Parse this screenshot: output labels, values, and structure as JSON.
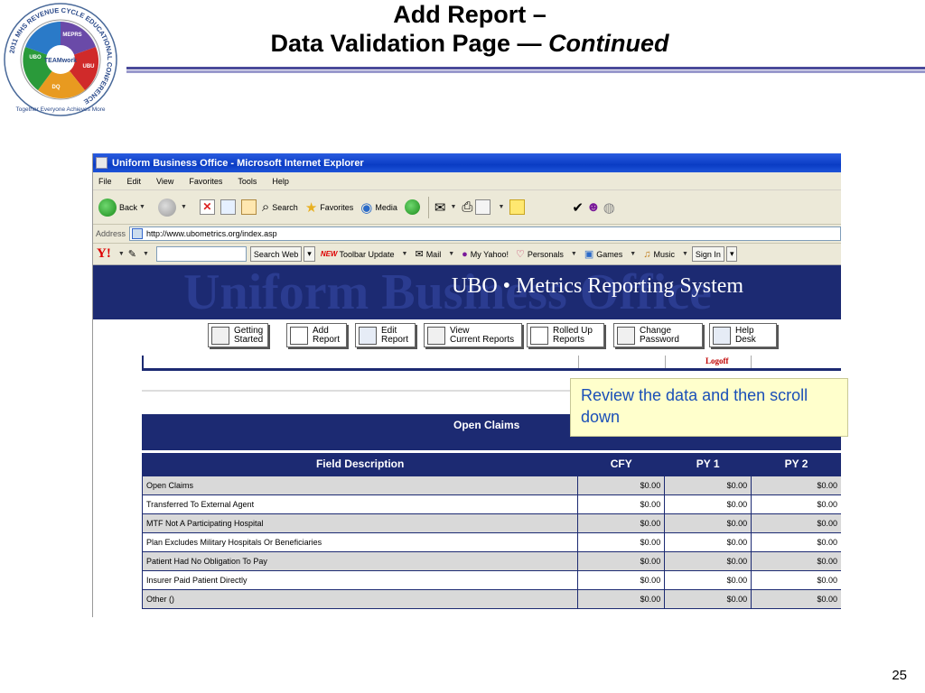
{
  "slide": {
    "title_line1": "Add Report –",
    "title_line2": "Data Validation Page —",
    "title_italic": "Continued",
    "page_number": "25",
    "logo": {
      "ring_text": "2011 MHS REVENUE CYCLE EDUCATIONAL CONFERENCE",
      "center": "TEAMwork",
      "segments": [
        "MEPRS",
        "UBO",
        "UBU",
        "DQ"
      ],
      "tagline": "Together Everyone Achieves More"
    }
  },
  "browser": {
    "window_title": "Uniform Business Office - Microsoft Internet Explorer",
    "menu": [
      "File",
      "Edit",
      "View",
      "Favorites",
      "Tools",
      "Help"
    ],
    "toolbar": {
      "back": "Back",
      "search": "Search",
      "favorites": "Favorites",
      "media": "Media"
    },
    "address_label": "Address",
    "url": "http://www.ubometrics.org/index.asp",
    "yahoo": {
      "logo": "Y!",
      "search_web": "Search Web",
      "new_badge": "NEW",
      "toolbar_update": "Toolbar Update",
      "mail": "Mail",
      "my_yahoo": "My Yahoo!",
      "personals": "Personals",
      "games": "Games",
      "music": "Music",
      "sign_in": "Sign In"
    }
  },
  "page": {
    "banner_bg": "Uniform Business Office",
    "banner_title": "UBO • Metrics Reporting System",
    "nav": [
      {
        "label": "Getting\nStarted"
      },
      {
        "label": "Add\nReport"
      },
      {
        "label": "Edit\nReport"
      },
      {
        "label": "View\nCurrent Reports"
      },
      {
        "label": "Rolled Up\nReports"
      },
      {
        "label": "Change\nPassword"
      },
      {
        "label": "Help\nDesk"
      }
    ],
    "logoff": "Logoff",
    "section_title": "Open Claims",
    "columns": [
      "Field Description",
      "CFY",
      "PY 1",
      "PY 2"
    ],
    "rows": [
      {
        "desc": "Open Claims",
        "cfy": "$0.00",
        "py1": "$0.00",
        "py2": "$0.00"
      },
      {
        "desc": "Transferred To External Agent",
        "cfy": "$0.00",
        "py1": "$0.00",
        "py2": "$0.00"
      },
      {
        "desc": "MTF Not A Participating Hospital",
        "cfy": "$0.00",
        "py1": "$0.00",
        "py2": "$0.00"
      },
      {
        "desc": "Plan Excludes Military Hospitals Or Beneficiaries",
        "cfy": "$0.00",
        "py1": "$0.00",
        "py2": "$0.00"
      },
      {
        "desc": "Patient Had No Obligation To Pay",
        "cfy": "$0.00",
        "py1": "$0.00",
        "py2": "$0.00"
      },
      {
        "desc": "Insurer Paid Patient Directly",
        "cfy": "$0.00",
        "py1": "$0.00",
        "py2": "$0.00"
      },
      {
        "desc": "Other  ()",
        "cfy": "$0.00",
        "py1": "$0.00",
        "py2": "$0.00"
      }
    ]
  },
  "callout": {
    "text": "Review the data and then scroll down"
  },
  "colors": {
    "navy": "#1c2a72",
    "callout_bg": "#ffffcc",
    "callout_text": "#1a4fb8",
    "logoff": "#c00000"
  }
}
